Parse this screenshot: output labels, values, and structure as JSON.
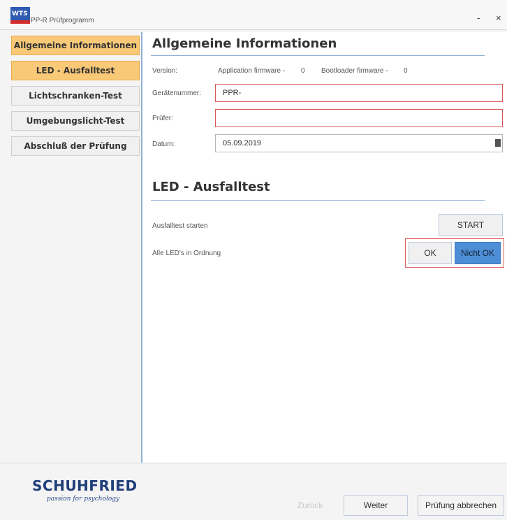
{
  "window": {
    "logo_text": "WTS",
    "title": "PP-R Prüfprogramm",
    "minimize": "-",
    "close": "×"
  },
  "sidebar": {
    "items": [
      {
        "label": "Allgemeine Informationen"
      },
      {
        "label": "LED - Ausfalltest"
      },
      {
        "label": "Lichtschranken-Test"
      },
      {
        "label": "Umgebungslicht-Test"
      },
      {
        "label": "Abschluß der Prüfung"
      }
    ]
  },
  "info": {
    "title": "Allgemeine Informationen",
    "version_label": "Version:",
    "app_fw": "Application firmware -",
    "app_fw_value": "0",
    "boot_fw": "Bootloader firmware -",
    "boot_fw_value": "0",
    "serial_label": "Gerätenummer:",
    "serial_value": "PPR-",
    "tester_label": "Prüfer:",
    "tester_value": "",
    "date_label": "Datum:",
    "date_value": "05.09.2019"
  },
  "led": {
    "title": "LED - Ausfalltest",
    "start_label": "Ausfalltest starten",
    "start_button": "START",
    "status_label": "Alle LED's in Ordnung",
    "ok_button": "OK",
    "not_ok_button": "Nicht OK"
  },
  "footer": {
    "brand": "SCHUHFRIED",
    "tagline": "passion for psychology",
    "back_button": "Zurück",
    "next_button": "Weiter",
    "cancel_button": "Prüfung abbrechen"
  }
}
